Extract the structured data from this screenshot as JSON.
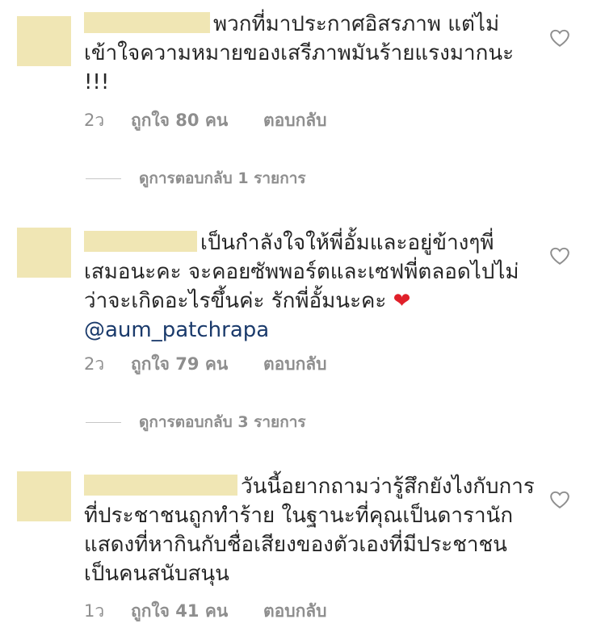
{
  "comments": [
    {
      "text": "พวกที่มาประกาศอิสรภาพ แต่ไม่เข้าใจความหมายของเสรีภาพมันร้ายแรงมากนะ !!!",
      "time": "2ว",
      "likes": "ถูกใจ 80 คน",
      "reply": "ตอบกลับ",
      "view_replies": "ดูการตอบกลับ 1 รายการ",
      "avatar_color": "#f0e6b4"
    },
    {
      "text": "เป็นกำลังใจให้พี่อั้มและอยู่ข้างๆพี่เสมอนะคะ จะคอยซัพพอร์ตและเซฟพี่ตลอดไปไม่ว่าจะเกิดอะไรขึ้นค่ะ รักพี่อั้มนะคะ",
      "emoji": "❤",
      "mention": "@aum_patchrapa",
      "time": "2ว",
      "likes": "ถูกใจ 79 คน",
      "reply": "ตอบกลับ",
      "view_replies": "ดูการตอบกลับ 3 รายการ",
      "avatar_color": "#f0e6b4"
    },
    {
      "text": "วันนี้อยากถามว่ารู้สึกยังไงกับการที่ประชาชนถูกทำร้าย ในฐานะที่คุณเป็นดารานักแสดงที่หากินกับชื่อเสียงของตัวเองที่มีประชาชนเป็นคนสนับสนุน",
      "time": "1ว",
      "likes": "ถูกใจ 41 คน",
      "reply": "ตอบกลับ",
      "avatar_color": "#f0e6b4"
    }
  ],
  "icons": {
    "like": "heart-outline-icon",
    "emoji": "red-heart-emoji"
  },
  "colors": {
    "redaction": "#f0e6b4",
    "mention": "#1a3a6b",
    "meta_text": "#8e8e8e"
  }
}
